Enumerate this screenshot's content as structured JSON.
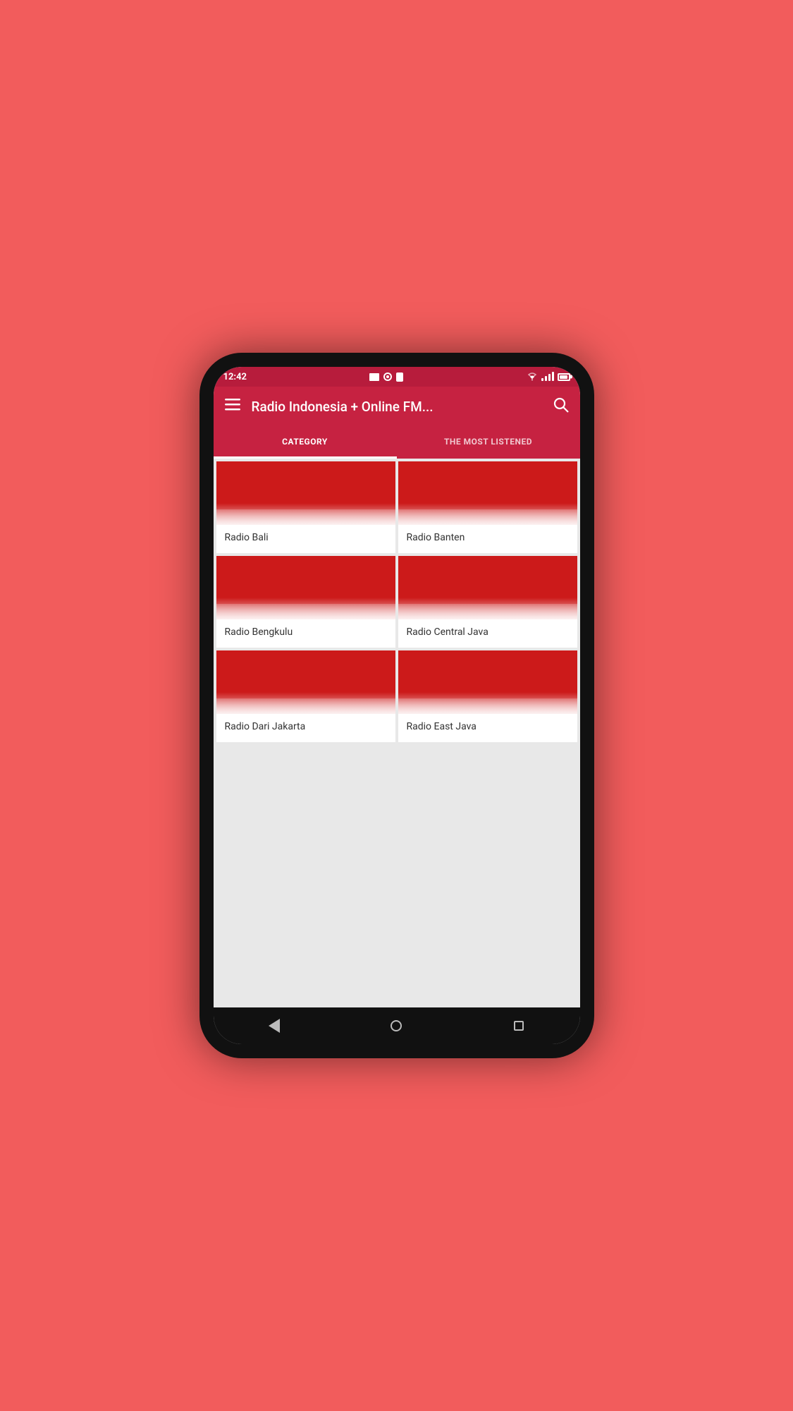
{
  "status_bar": {
    "time": "12:42"
  },
  "toolbar": {
    "title": "Radio Indonesia + Online FM...",
    "menu_label": "≡",
    "search_label": "🔍"
  },
  "tabs": [
    {
      "id": "category",
      "label": "CATEGORY",
      "active": true
    },
    {
      "id": "most_listened",
      "label": "THE MOST LISTENED",
      "active": false
    }
  ],
  "cards": [
    {
      "id": "radio-bali",
      "label": "Radio Bali"
    },
    {
      "id": "radio-banten",
      "label": "Radio Banten"
    },
    {
      "id": "radio-bengkulu",
      "label": "Radio Bengkulu"
    },
    {
      "id": "radio-central-java",
      "label": "Radio Central Java"
    },
    {
      "id": "radio-dari-jakarta",
      "label": "Radio Dari Jakarta"
    },
    {
      "id": "radio-east-java",
      "label": "Radio East Java"
    }
  ],
  "colors": {
    "statusbar": "#b71c3c",
    "toolbar": "#c62241",
    "card_image_top": "#cc1a1a",
    "card_bg": "#ffffff"
  }
}
